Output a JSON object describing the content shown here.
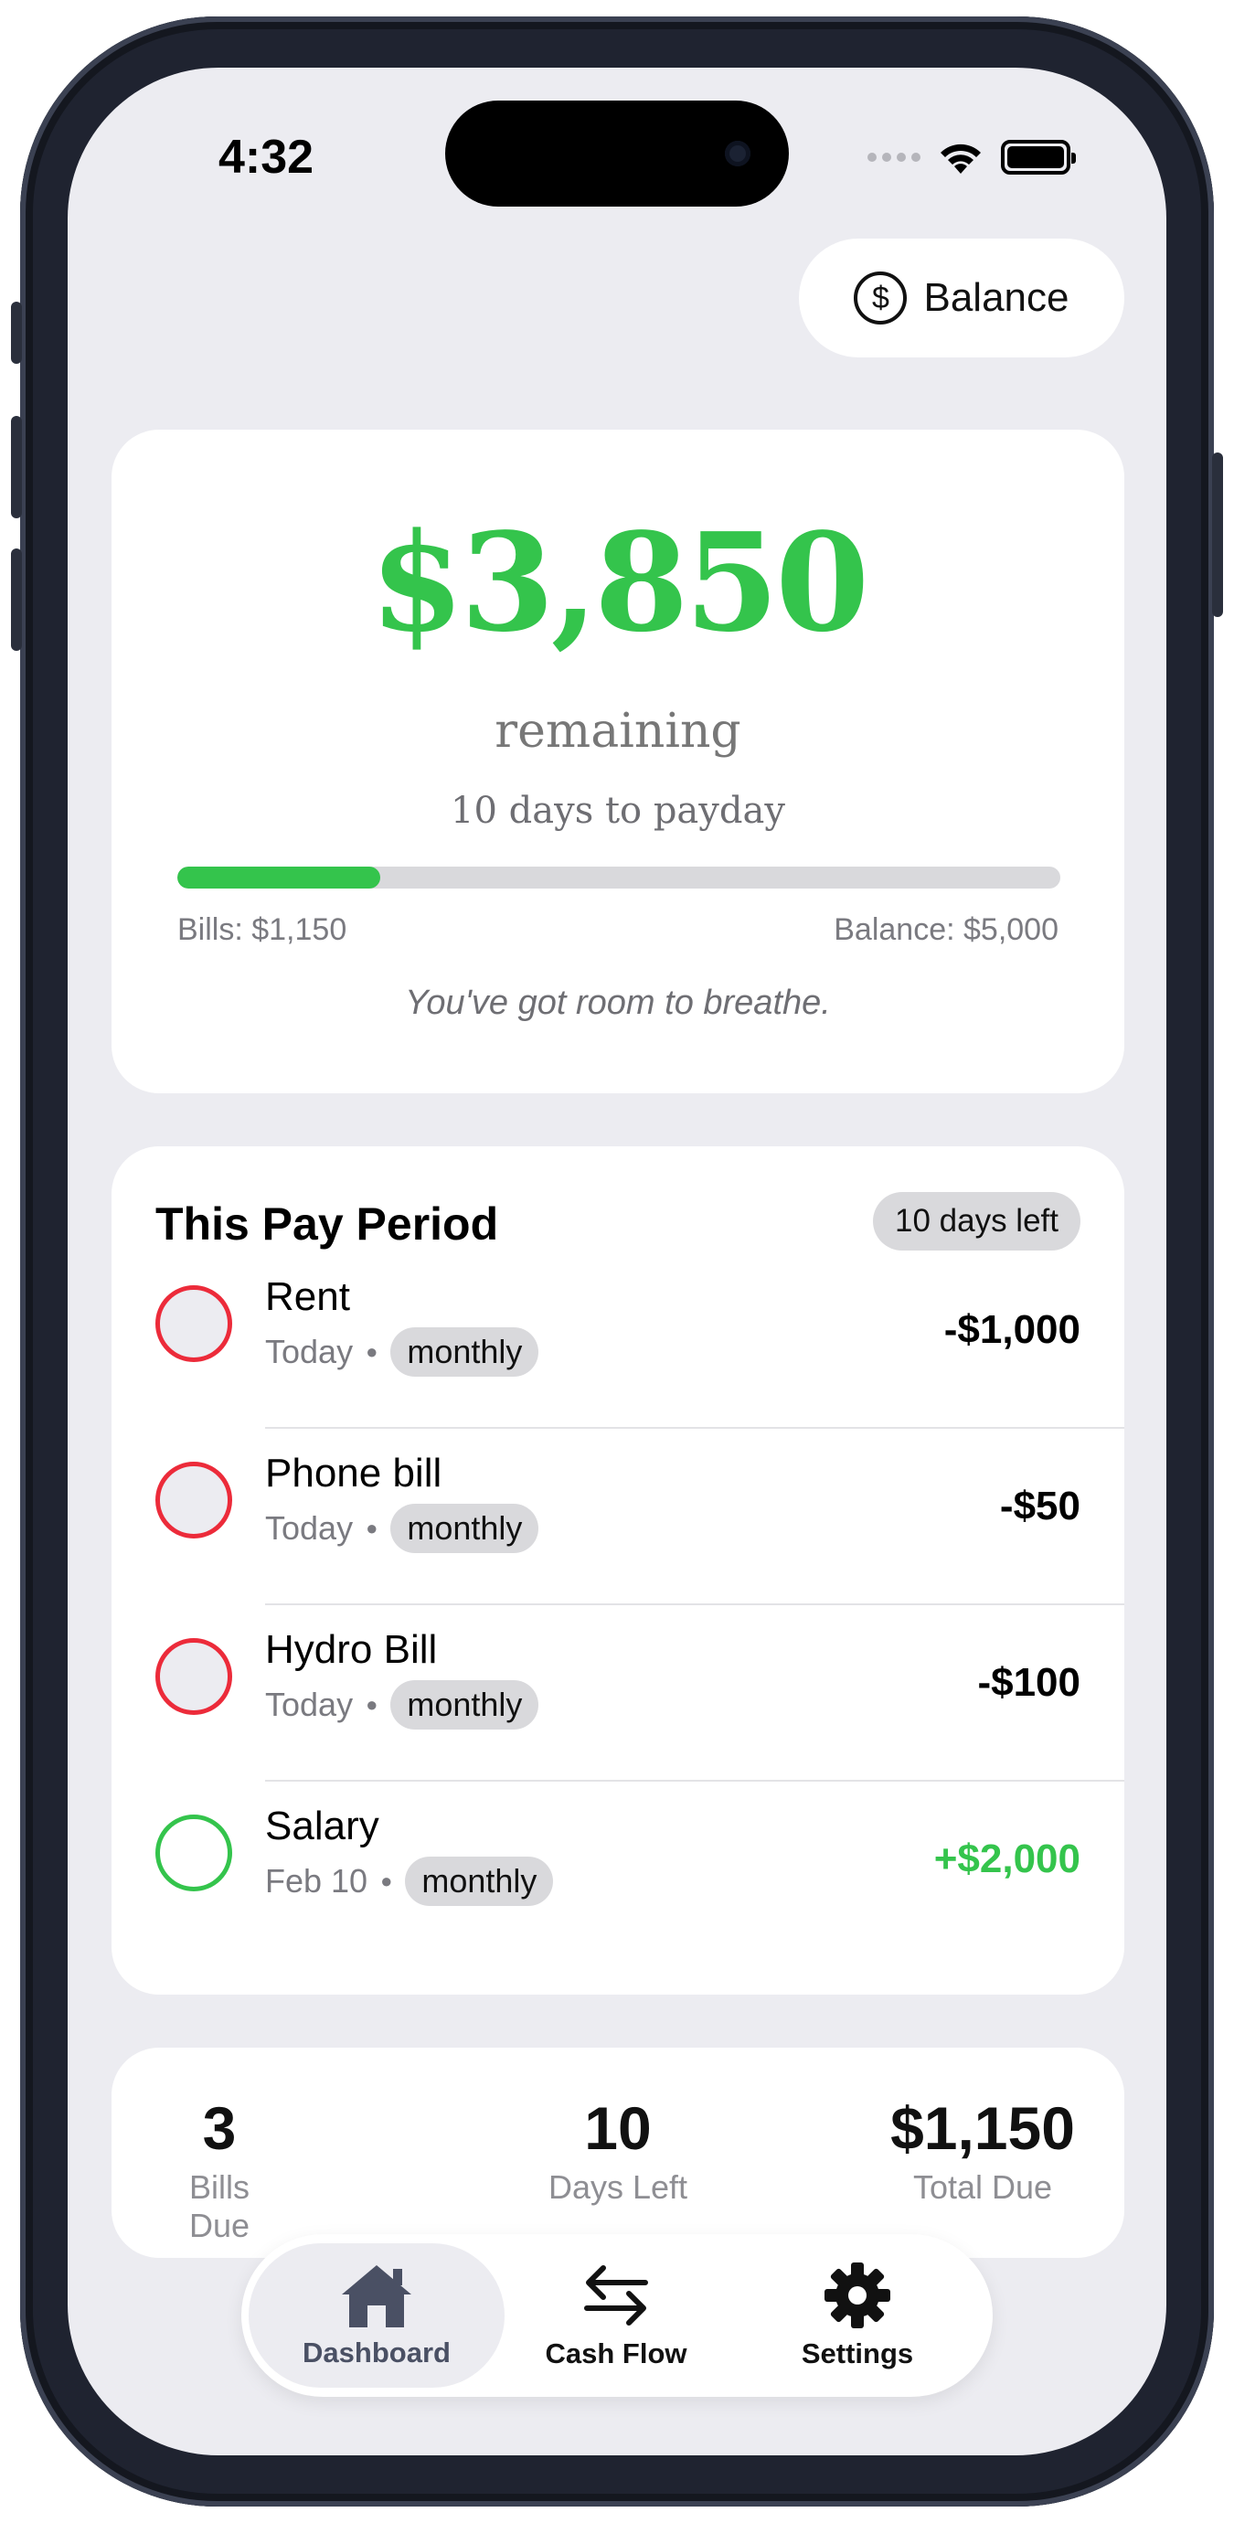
{
  "status": {
    "time": "4:32"
  },
  "header": {
    "balance_label": "Balance",
    "balance_icon": "$"
  },
  "hero": {
    "amount": "$3,850",
    "remaining_label": "remaining",
    "payday_label": "10 days to payday",
    "progress_fraction": 0.23,
    "bills_label": "Bills: $1,150",
    "balance_label": "Balance: $5,000",
    "note": "You've got room to breathe."
  },
  "period": {
    "title": "This Pay Period",
    "days_left": "10 days left",
    "items": [
      {
        "name": "Rent",
        "date": "Today",
        "tag": "monthly",
        "amount": "-$1,000",
        "type": "bill"
      },
      {
        "name": "Phone bill",
        "date": "Today",
        "tag": "monthly",
        "amount": "-$50",
        "type": "bill"
      },
      {
        "name": "Hydro Bill",
        "date": "Today",
        "tag": "monthly",
        "amount": "-$100",
        "type": "bill"
      },
      {
        "name": "Salary",
        "date": "Feb 10",
        "tag": "monthly",
        "amount": "+$2,000",
        "type": "income"
      }
    ]
  },
  "stats": [
    {
      "value": "3",
      "label": "Bills Due"
    },
    {
      "value": "10",
      "label": "Days Left"
    },
    {
      "value": "$1,150",
      "label": "Total Due"
    }
  ],
  "tabs": [
    {
      "label": "Dashboard",
      "icon": "house-icon",
      "active": true
    },
    {
      "label": "Cash Flow",
      "icon": "arrows-exchange-icon",
      "active": false
    },
    {
      "label": "Settings",
      "icon": "gear-icon",
      "active": false
    }
  ],
  "colors": {
    "accent_green": "#34c44c",
    "bill_red": "#ec2b3a",
    "background": "#ececf1"
  }
}
